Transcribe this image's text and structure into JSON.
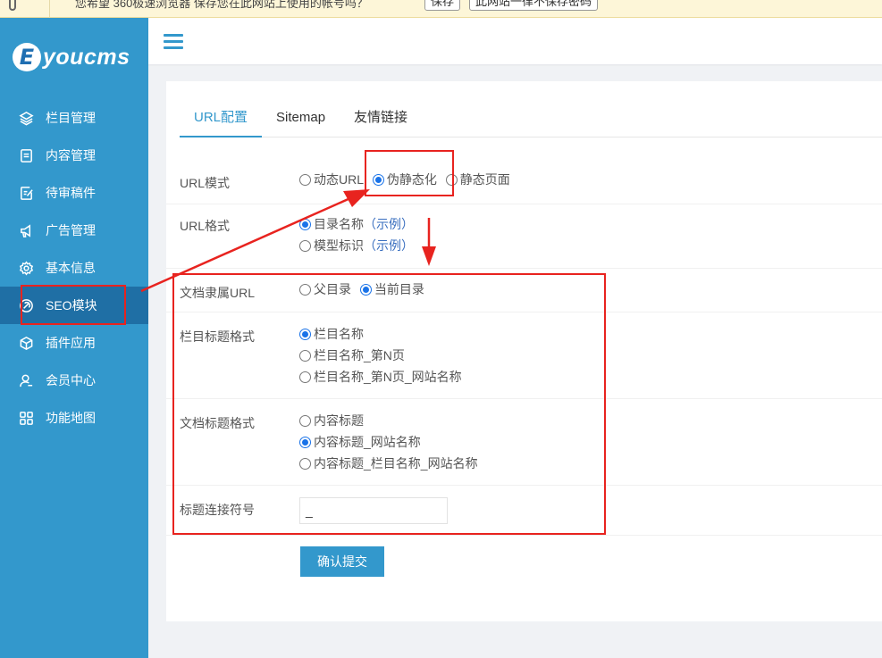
{
  "topbar": {
    "message": "您希望 360极速浏览器 保存您在此网站上使用的帐号吗？",
    "save_button": "保存",
    "never_button": "此网站一律不保存密码"
  },
  "logo": {
    "letter": "E",
    "text": "youcms"
  },
  "sidebar": {
    "items": [
      {
        "label": "栏目管理",
        "icon": "layers-icon"
      },
      {
        "label": "内容管理",
        "icon": "document-icon"
      },
      {
        "label": "待审稿件",
        "icon": "edit-document-icon"
      },
      {
        "label": "广告管理",
        "icon": "megaphone-icon"
      },
      {
        "label": "基本信息",
        "icon": "gear-icon"
      },
      {
        "label": "SEO模块",
        "icon": "seo-icon",
        "active": true
      },
      {
        "label": "插件应用",
        "icon": "cube-icon"
      },
      {
        "label": "会员中心",
        "icon": "user-icon"
      },
      {
        "label": "功能地图",
        "icon": "grid-icon"
      }
    ]
  },
  "tabs": [
    "URL配置",
    "Sitemap",
    "友情链接"
  ],
  "form": {
    "url_mode": {
      "label": "URL模式",
      "options": [
        "动态URL",
        "伪静态化",
        "静态页面"
      ],
      "selected": "伪静态化"
    },
    "url_format": {
      "label": "URL格式",
      "options": [
        {
          "text": "目录名称",
          "example": "（示例）"
        },
        {
          "text": "模型标识",
          "example": "（示例）"
        }
      ],
      "selected": "目录名称"
    },
    "doc_url": {
      "label": "文档隶属URL",
      "options": [
        "父目录",
        "当前目录"
      ],
      "selected": "当前目录"
    },
    "column_title": {
      "label": "栏目标题格式",
      "options": [
        "栏目名称",
        "栏目名称_第N页",
        "栏目名称_第N页_网站名称"
      ],
      "selected": "栏目名称"
    },
    "doc_title": {
      "label": "文档标题格式",
      "options": [
        "内容标题",
        "内容标题_网站名称",
        "内容标题_栏目名称_网站名称"
      ],
      "selected": "内容标题_网站名称"
    },
    "separator": {
      "label": "标题连接符号",
      "value": "_"
    },
    "submit": "确认提交"
  },
  "colors": {
    "sidebar": "#3398cc",
    "sidebar_active": "#1f6fa5",
    "accent": "#3398cc",
    "annotation": "#e8231f"
  }
}
